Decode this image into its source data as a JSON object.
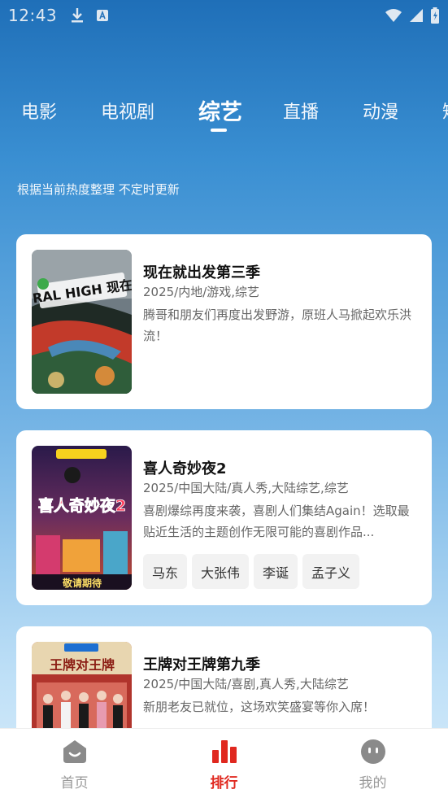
{
  "status_bar": {
    "time": "12:43"
  },
  "tabs": [
    {
      "label": "电影"
    },
    {
      "label": "电视剧"
    },
    {
      "label": "综艺"
    },
    {
      "label": "直播"
    },
    {
      "label": "动漫"
    },
    {
      "label": "短"
    }
  ],
  "active_tab": "综艺",
  "subtitle": "根据当前热度整理 不定时更新",
  "cards": [
    {
      "title": "现在就出发第三季",
      "meta": "2025/内地/游戏,综艺",
      "desc": "腾哥和朋友们再度出发野游，原班人马掀起欢乐洪流！",
      "poster_text": "NATURAL HIGH 现在就出发",
      "tags": []
    },
    {
      "title": "喜人奇妙夜2",
      "meta": "2025/中国大陆/真人秀,大陆综艺,综艺",
      "desc": "喜剧爆综再度来袭，喜剧人们集结Again！选取最贴近生活的主题创作无限可能的喜剧作品...",
      "poster_text": "喜人奇妙夜2",
      "poster_sub": "敬请期待",
      "tags": [
        "马东",
        "大张伟",
        "李诞",
        "孟子义"
      ]
    },
    {
      "title": "王牌对王牌第九季",
      "meta": "2025/中国大陆/喜剧,真人秀,大陆综艺",
      "desc": "新朋老友已就位，这场欢笑盛宴等你入席！",
      "poster_text": "王牌对王牌",
      "tags": []
    }
  ],
  "bottom_nav": [
    {
      "label": "首页",
      "icon": "home-icon"
    },
    {
      "label": "排行",
      "icon": "ranking-icon"
    },
    {
      "label": "我的",
      "icon": "profile-icon"
    }
  ],
  "colors": {
    "accent": "#e0281f",
    "inactive": "#999999"
  }
}
